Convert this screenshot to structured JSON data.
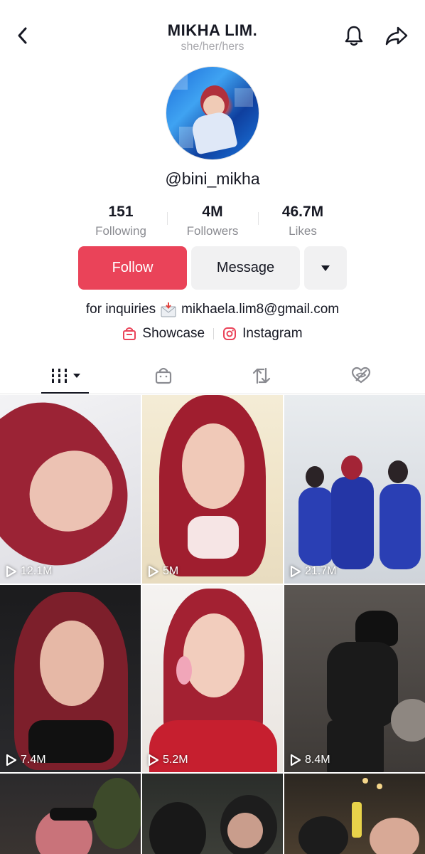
{
  "header": {
    "title": "MIKHA LIM.",
    "pronouns": "she/her/hers",
    "back_icon": "chevron-left-icon",
    "bell_icon": "bell-icon",
    "share_icon": "share-arrow-icon"
  },
  "profile": {
    "username": "@bini_mikha",
    "avatar_icon": "avatar"
  },
  "stats": [
    {
      "value": "151",
      "label": "Following"
    },
    {
      "value": "4M",
      "label": "Followers"
    },
    {
      "value": "46.7M",
      "label": "Likes"
    }
  ],
  "actions": {
    "follow_label": "Follow",
    "message_label": "Message",
    "more_icon": "caret-down-icon"
  },
  "bio": {
    "prefix": "for inquiries",
    "email": "mikhaela.lim8@gmail.com"
  },
  "links": {
    "showcase": "Showcase",
    "instagram": "Instagram"
  },
  "tabs": [
    {
      "icon": "videos-grid-icon"
    },
    {
      "icon": "shop-bag-icon"
    },
    {
      "icon": "repost-icon"
    },
    {
      "icon": "liked-hidden-icon"
    }
  ],
  "videos": [
    {
      "views": "12.1M"
    },
    {
      "views": "5M"
    },
    {
      "views": "21.7M"
    },
    {
      "views": "7.4M"
    },
    {
      "views": "5.2M"
    },
    {
      "views": "8.4M"
    },
    {
      "views": ""
    },
    {
      "views": ""
    },
    {
      "views": ""
    }
  ],
  "colors": {
    "accent": "#ea4359",
    "button_gray": "#f1f1f2",
    "muted_text": "#8a8b91"
  }
}
